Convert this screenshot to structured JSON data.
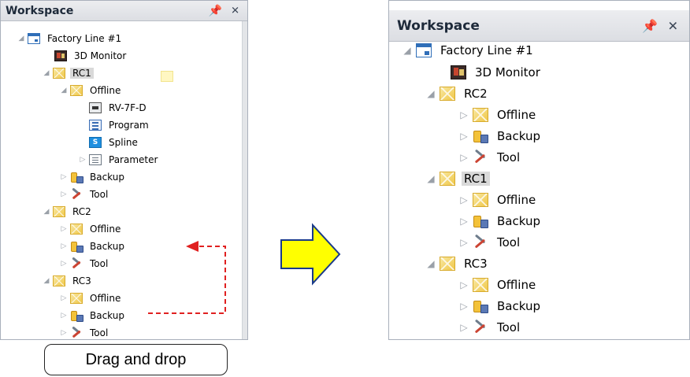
{
  "left_panel": {
    "title": "Workspace",
    "pin_glyph": "P",
    "close_glyph": "✕",
    "tree": [
      {
        "label": "Factory Line #1",
        "icon": "factory-line-icon",
        "toggle": "◢",
        "expanded": true
      },
      {
        "label": "3D Monitor",
        "icon": "3d-monitor-icon",
        "toggle": ""
      },
      {
        "label": "RC1",
        "icon": "rc-folder-icon",
        "toggle": "◢",
        "expanded": true,
        "selected": true
      },
      {
        "label": "Offline",
        "icon": "rc-folder-icon",
        "toggle": "◢",
        "expanded": true
      },
      {
        "label": "RV-7F-D",
        "icon": "robot-icon",
        "toggle": ""
      },
      {
        "label": "Program",
        "icon": "program-icon",
        "toggle": ""
      },
      {
        "label": "Spline",
        "icon": "spline-icon",
        "toggle": ""
      },
      {
        "label": "Parameter",
        "icon": "parameter-icon",
        "toggle": "▷"
      },
      {
        "label": "Backup",
        "icon": "backup-icon",
        "toggle": "▷"
      },
      {
        "label": "Tool",
        "icon": "tool-icon",
        "toggle": "▷"
      },
      {
        "label": "RC2",
        "icon": "rc-folder-icon",
        "toggle": "◢",
        "expanded": true
      },
      {
        "label": "Offline",
        "icon": "rc-folder-icon",
        "toggle": "▷"
      },
      {
        "label": "Backup",
        "icon": "backup-icon",
        "toggle": "▷"
      },
      {
        "label": "Tool",
        "icon": "tool-icon",
        "toggle": "▷"
      },
      {
        "label": "RC3",
        "icon": "rc-folder-icon",
        "toggle": "◢",
        "expanded": true
      },
      {
        "label": "Offline",
        "icon": "rc-folder-icon",
        "toggle": "▷"
      },
      {
        "label": "Backup",
        "icon": "backup-icon",
        "toggle": "▷"
      },
      {
        "label": "Tool",
        "icon": "tool-icon",
        "toggle": "▷"
      }
    ]
  },
  "right_panel": {
    "title": "Workspace",
    "pin_glyph": "P",
    "close_glyph": "✕",
    "tree": [
      {
        "label": "Factory Line #1",
        "icon": "factory-line-icon",
        "toggle": "◢",
        "expanded": true
      },
      {
        "label": "3D Monitor",
        "icon": "3d-monitor-icon",
        "toggle": ""
      },
      {
        "label": "RC2",
        "icon": "rc-folder-icon",
        "toggle": "◢",
        "expanded": true
      },
      {
        "label": "Offline",
        "icon": "rc-folder-icon",
        "toggle": "▷"
      },
      {
        "label": "Backup",
        "icon": "backup-icon",
        "toggle": "▷"
      },
      {
        "label": "Tool",
        "icon": "tool-icon",
        "toggle": "▷"
      },
      {
        "label": "RC1",
        "icon": "rc-folder-icon",
        "toggle": "◢",
        "expanded": true,
        "selected": true
      },
      {
        "label": "Offline",
        "icon": "rc-folder-icon",
        "toggle": "▷"
      },
      {
        "label": "Backup",
        "icon": "backup-icon",
        "toggle": "▷"
      },
      {
        "label": "Tool",
        "icon": "tool-icon",
        "toggle": "▷"
      },
      {
        "label": "RC3",
        "icon": "rc-folder-icon",
        "toggle": "◢",
        "expanded": true
      },
      {
        "label": "Offline",
        "icon": "rc-folder-icon",
        "toggle": "▷"
      },
      {
        "label": "Backup",
        "icon": "backup-icon",
        "toggle": "▷"
      },
      {
        "label": "Tool",
        "icon": "tool-icon",
        "toggle": "▷"
      }
    ]
  },
  "caption": "Drag and drop",
  "colors": {
    "arrow_fill": "#ffff00",
    "arrow_stroke": "#1a3a8a",
    "drag_line": "#e02020",
    "selection": "#d9d9d9"
  }
}
